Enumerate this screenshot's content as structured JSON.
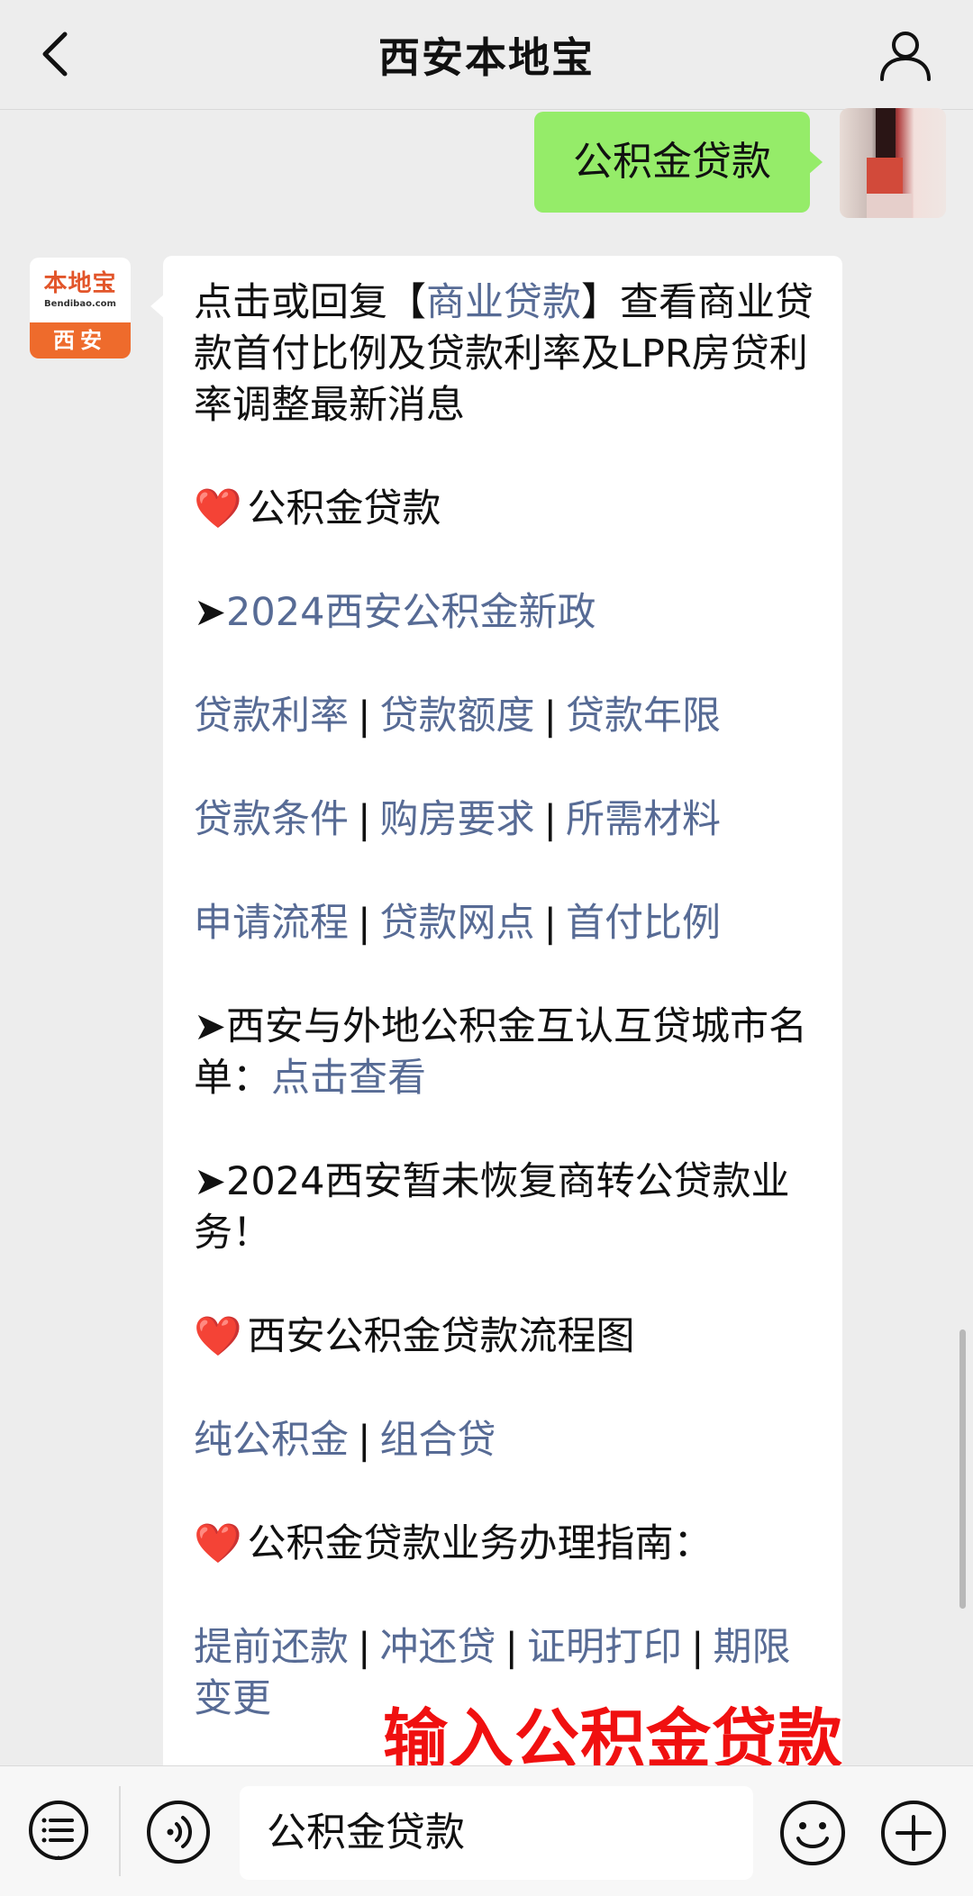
{
  "header": {
    "title": "西安本地宝",
    "back_icon": "chevron-left-icon",
    "profile_icon": "user-icon"
  },
  "sent_message": {
    "text": "公积金贷款"
  },
  "bot": {
    "avatar": {
      "logo_text": "本地宝",
      "logo_url": "Bendibao.com",
      "city": "西安"
    }
  },
  "reply": {
    "intro_prefix": "点击或回复【",
    "intro_link": "商业贷款",
    "intro_suffix": "】查看商业贷款首付比例及贷款利率及LPR房贷利率调整最新消息",
    "heart": "❤️",
    "section1_title": "公积金贷款",
    "arrow": "➤",
    "policy_link": "2024西安公积金新政",
    "links_row1": [
      "贷款利率",
      "贷款额度",
      "贷款年限"
    ],
    "links_row2": [
      "贷款条件",
      "购房要求",
      "所需材料"
    ],
    "links_row3": [
      "申请流程",
      "贷款网点",
      "首付比例"
    ],
    "separator": "|",
    "mutual_text": "西安与外地公积金互认互贷城市名单：",
    "mutual_link": "点击查看",
    "notice_text": "2024西安暂未恢复商转公贷款业务！",
    "section2_title": "西安公积金贷款流程图",
    "links_row4": [
      "纯公积金",
      "组合贷"
    ],
    "section3_title": "公积金贷款业务办理指南：",
    "links_row5": [
      "提前还款",
      "冲还贷",
      "证明打印",
      "期限变更"
    ]
  },
  "overlay_caption": "输入公积金贷款",
  "input_bar": {
    "value": "公积金贷款",
    "menu_icon": "menu-list-icon",
    "voice_icon": "voice-icon",
    "emoji_icon": "emoji-icon",
    "plus_icon": "plus-icon"
  },
  "colors": {
    "link": "#576b95",
    "sent_bubble": "#95ec69",
    "caption": "#f01010",
    "background": "#ededed"
  }
}
